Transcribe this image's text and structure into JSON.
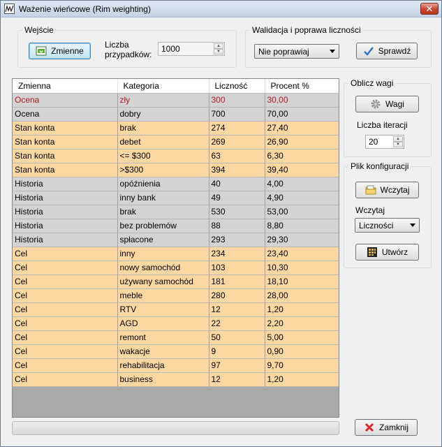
{
  "window": {
    "title": "Ważenie wieńcowe (Rim weighting)",
    "close_glyph": "✕"
  },
  "input_group": {
    "legend": "Wejście",
    "variables_button": "Zmienne",
    "case_count_label_line1": "Liczba",
    "case_count_label_line2": "przypadków:",
    "case_count_value": "1000"
  },
  "validation_group": {
    "legend": "Walidacja i poprawa liczności",
    "mode_selected": "Nie poprawiaj",
    "check_button": "Sprawdź"
  },
  "weights_group": {
    "legend": "Oblicz wagi",
    "weights_button": "Wagi",
    "iterations_label": "Liczba iteracji",
    "iterations_value": "20"
  },
  "config_group": {
    "legend": "Plik konfiguracji",
    "load_button": "Wczytaj",
    "load_label": "Wczytaj",
    "load_selected": "Liczności",
    "create_button": "Utwórz"
  },
  "close_button": "Zamknij",
  "grid": {
    "columns": [
      "Zmienna",
      "Kategoria",
      "Liczność",
      "Procent %"
    ],
    "rows": [
      {
        "variable": "Ocena",
        "category": "zły",
        "count": "300",
        "percent": "30,00"
      },
      {
        "variable": "Ocena",
        "category": "dobry",
        "count": "700",
        "percent": "70,00"
      },
      {
        "variable": "Stan konta",
        "category": "brak",
        "count": "274",
        "percent": "27,40"
      },
      {
        "variable": "Stan konta",
        "category": "debet",
        "count": "269",
        "percent": "26,90"
      },
      {
        "variable": "Stan konta",
        "category": "<= $300",
        "count": "63",
        "percent": "6,30"
      },
      {
        "variable": "Stan konta",
        "category": ">$300",
        "count": "394",
        "percent": "39,40"
      },
      {
        "variable": "Historia",
        "category": "opóźnienia",
        "count": "40",
        "percent": "4,00"
      },
      {
        "variable": "Historia",
        "category": "inny bank",
        "count": "49",
        "percent": "4,90"
      },
      {
        "variable": "Historia",
        "category": "brak",
        "count": "530",
        "percent": "53,00"
      },
      {
        "variable": "Historia",
        "category": "bez problemów",
        "count": "88",
        "percent": "8,80"
      },
      {
        "variable": "Historia",
        "category": "spłacone",
        "count": "293",
        "percent": "29,30"
      },
      {
        "variable": "Cel",
        "category": "inny",
        "count": "234",
        "percent": "23,40"
      },
      {
        "variable": "Cel",
        "category": "nowy samochód",
        "count": "103",
        "percent": "10,30"
      },
      {
        "variable": "Cel",
        "category": "używany samochód",
        "count": "181",
        "percent": "18,10"
      },
      {
        "variable": "Cel",
        "category": "meble",
        "count": "280",
        "percent": "28,00"
      },
      {
        "variable": "Cel",
        "category": "RTV",
        "count": "12",
        "percent": "1,20"
      },
      {
        "variable": "Cel",
        "category": "AGD",
        "count": "22",
        "percent": "2,20"
      },
      {
        "variable": "Cel",
        "category": "remont",
        "count": "50",
        "percent": "5,00"
      },
      {
        "variable": "Cel",
        "category": "wakacje",
        "count": "9",
        "percent": "0,90"
      },
      {
        "variable": "Cel",
        "category": "rehabilitacja",
        "count": "97",
        "percent": "9,70"
      },
      {
        "variable": "Cel",
        "category": "business",
        "count": "12",
        "percent": "1,20"
      }
    ]
  },
  "progress": 0,
  "colors": {
    "row_gray": "#d3d3d3",
    "row_orange": "#fcd7a1",
    "selected_text": "#b0192a",
    "grid_empty": "#a9a9a9"
  }
}
